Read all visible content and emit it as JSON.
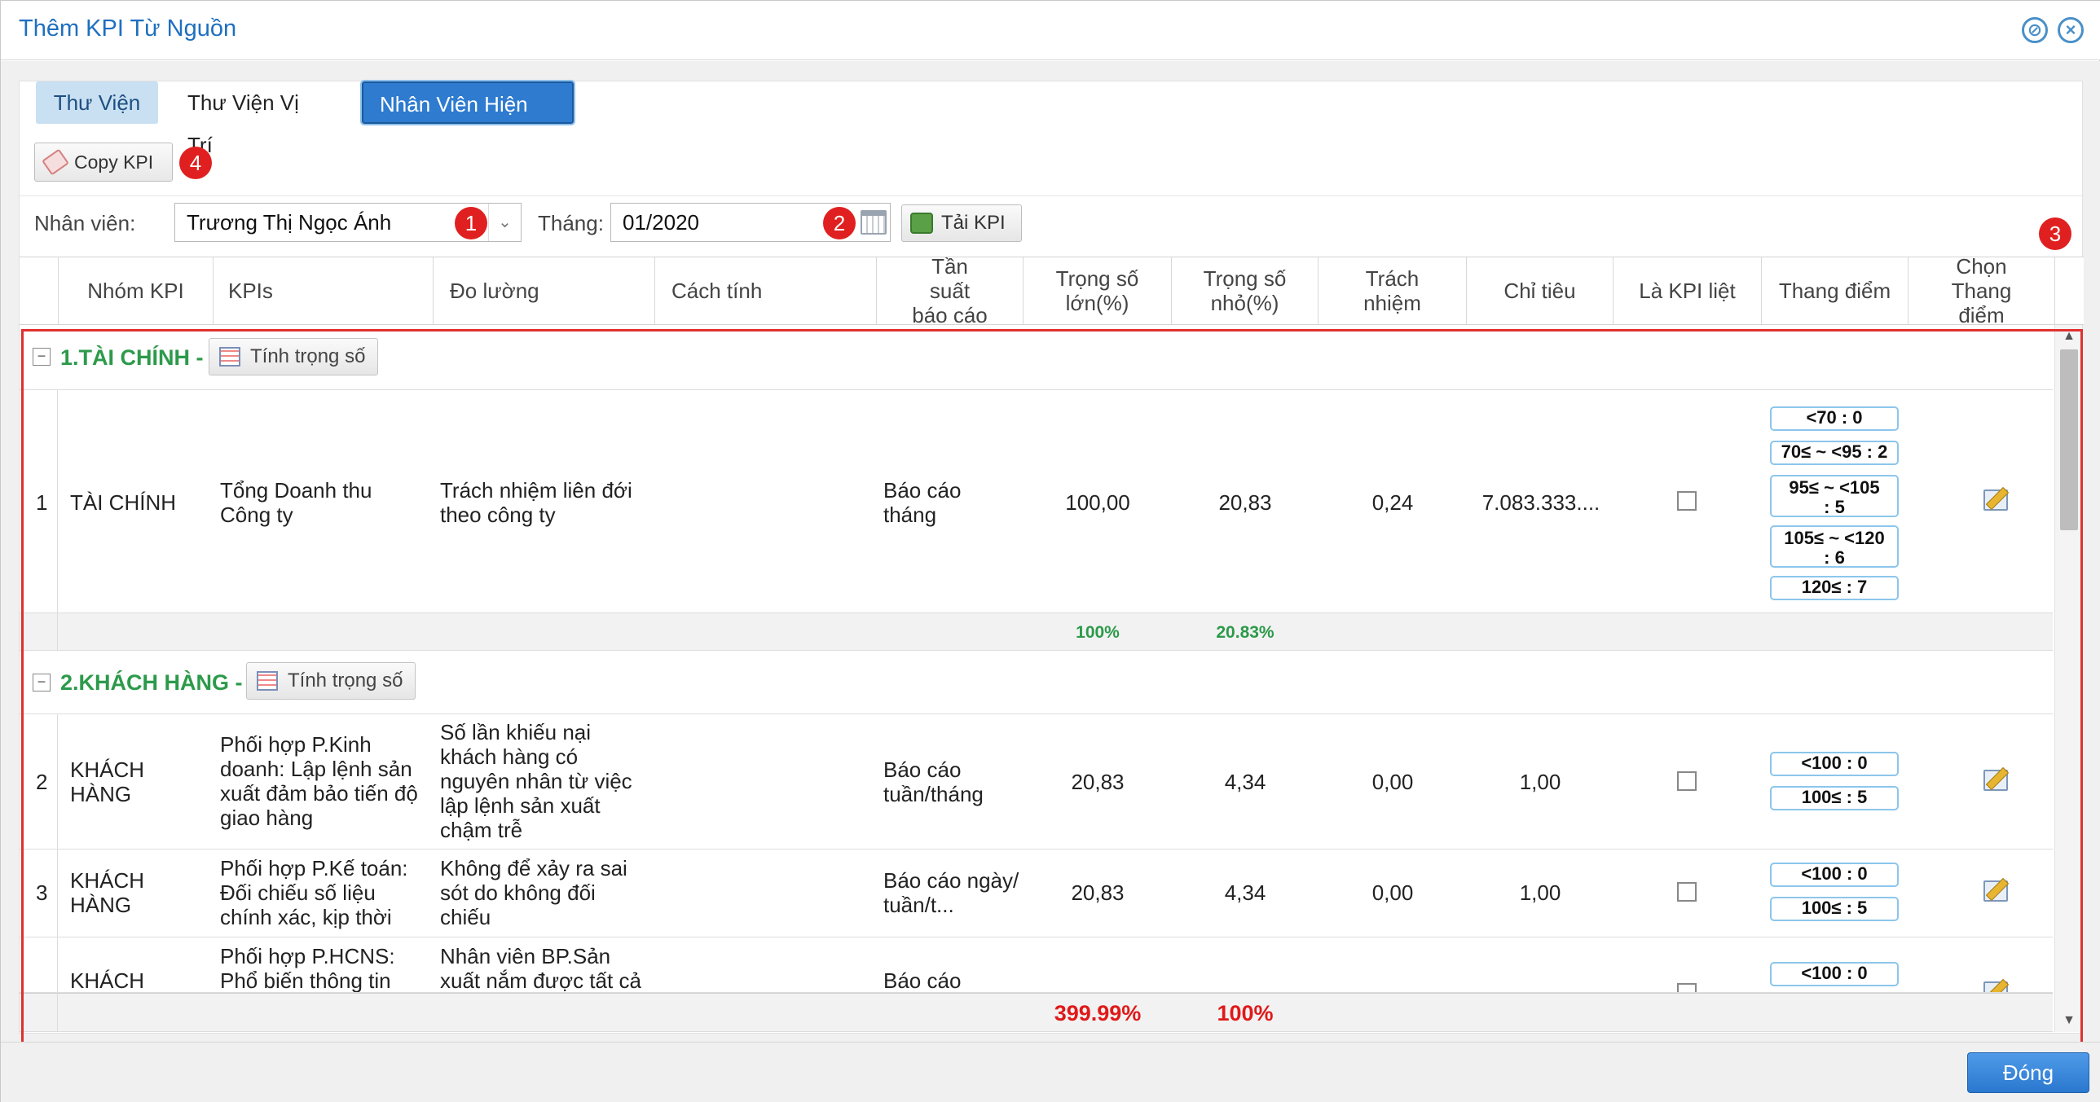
{
  "window": {
    "title": "Thêm KPI Từ Nguồn",
    "close_button": "Đóng"
  },
  "tabs": [
    {
      "label": "Thư Viện"
    },
    {
      "label": "Thư Viện Vị Trí"
    },
    {
      "label": "Nhân Viên Hiện Có"
    }
  ],
  "toolbar": {
    "copy_label": "Copy KPI"
  },
  "filters": {
    "employee_label": "Nhân viên:",
    "employee_value": "Trương Thị Ngọc Ánh",
    "month_label": "Tháng:",
    "month_value": "01/2020",
    "load_label": "Tải KPI"
  },
  "badges": [
    "1",
    "2",
    "3",
    "4"
  ],
  "columns": [
    "Nhóm KPI",
    "KPIs",
    "Đo lường",
    "Cách tính",
    "Tần suất báo cáo",
    "Trọng số lớn(%)",
    "Trọng số nhỏ(%)",
    "Trách nhiệm",
    "Chỉ tiêu",
    "Là KPI liệt",
    "Thang điểm",
    "Chọn Thang điểm"
  ],
  "groups": [
    {
      "title": "1.TÀI CHÍNH -",
      "weigh_label": "Tính trọng số",
      "rows": [
        {
          "no": "1",
          "group": "TÀI CHÍNH",
          "kpi": "Tổng Doanh thu Công ty",
          "measure": "Trách nhiệm liên đới theo công ty",
          "method": "",
          "frequency": "Báo cáo tháng",
          "weight_big": "100,00",
          "weight_small": "20,83",
          "responsibility": "0,24",
          "target": "7.083.333....",
          "scores": [
            "<70 : 0",
            "70≤ ~ <95 : 2",
            "95≤ ~ <105 : 5",
            "105≤ ~ <120 : 6",
            "120≤ : 7"
          ]
        }
      ],
      "sum_big": "100%",
      "sum_small": "20.83%"
    },
    {
      "title": "2.KHÁCH HÀNG -",
      "weigh_label": "Tính trọng số",
      "rows": [
        {
          "no": "2",
          "group": "KHÁCH HÀNG",
          "kpi": "Phối hợp P.Kinh doanh: Lập lệnh sản xuất đảm bảo tiến độ giao hàng",
          "measure": "Số lần khiếu nại khách hàng có nguyên nhân từ việc lập lệnh sản xuất chậm trễ",
          "method": "",
          "frequency": "Báo cáo tuần/tháng",
          "weight_big": "20,83",
          "weight_small": "4,34",
          "responsibility": "0,00",
          "target": "1,00",
          "scores": [
            "<100 : 0",
            "100≤ : 5"
          ]
        },
        {
          "no": "3",
          "group": "KHÁCH HÀNG",
          "kpi": "Phối hợp P.Kế toán: Đối chiếu số liệu chính xác, kịp thời",
          "measure": "Không để xảy ra sai sót do không đối chiếu",
          "method": "",
          "frequency": "Báo cáo ngày/tuần/t...",
          "weight_big": "20,83",
          "weight_small": "4,34",
          "responsibility": "0,00",
          "target": "1,00",
          "scores": [
            "<100 : 0",
            "100≤ : 5"
          ]
        },
        {
          "no": "",
          "group": "KHÁCH",
          "kpi": "Phối hợp P.HCNS: Phổ biến thông tin",
          "measure": "Nhân viên BP.Sản xuất nắm được tất cả",
          "method": "",
          "frequency": "Báo cáo",
          "scores": [
            "<100 : 0"
          ]
        }
      ]
    }
  ],
  "totals": {
    "weight_big": "399.99%",
    "weight_small": "100%"
  },
  "colors": {
    "accent": "#2e7bcf",
    "group_green": "#2c9a4a",
    "alert_red": "#e01919"
  }
}
